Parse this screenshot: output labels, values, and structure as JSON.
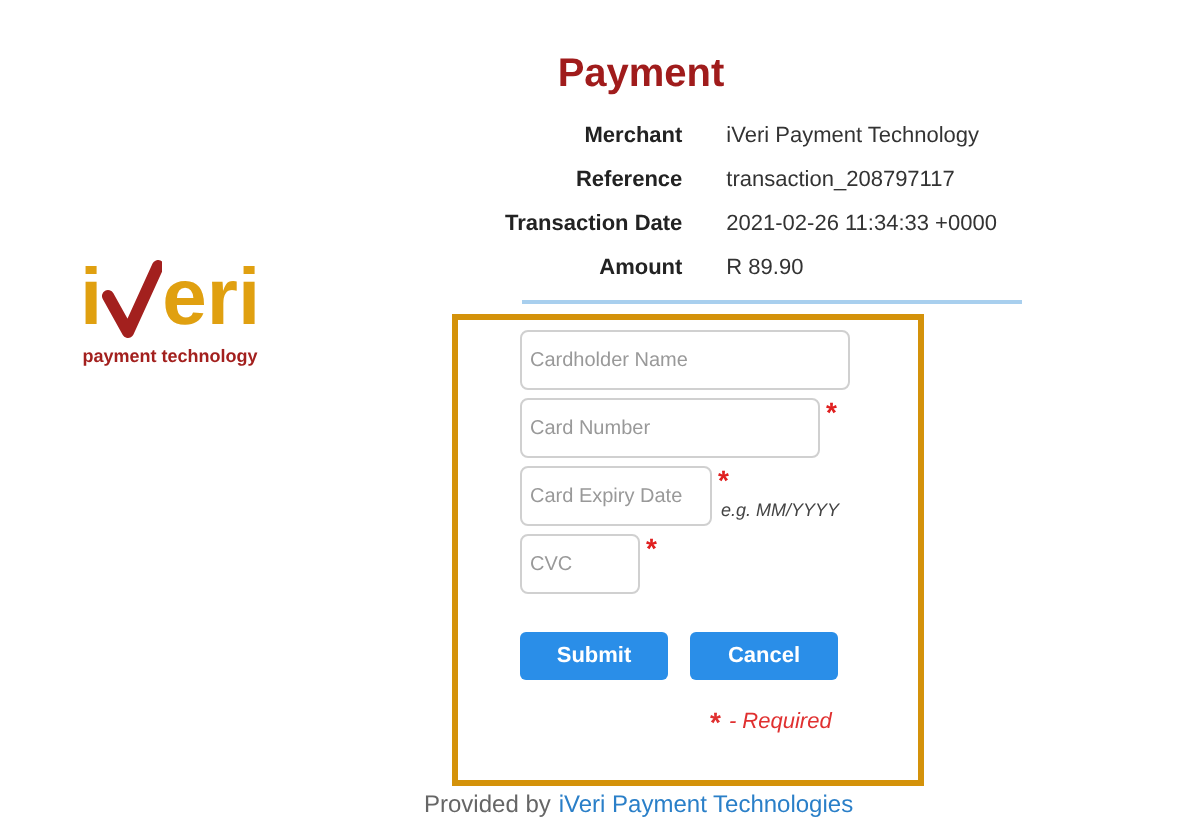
{
  "logo": {
    "name_start": "i",
    "name_end": "eri",
    "tagline": "payment technology"
  },
  "title": "Payment",
  "details": [
    {
      "label": "Merchant",
      "value": "iVeri Payment Technology"
    },
    {
      "label": "Reference",
      "value": "transaction_208797117"
    },
    {
      "label": "Transaction Date",
      "value": "2021-02-26 11:34:33 +0000"
    },
    {
      "label": "Amount",
      "value": "R 89.90"
    }
  ],
  "fields": [
    {
      "placeholder": "Cardholder Name",
      "required": false
    },
    {
      "placeholder": "Card Number",
      "required": true
    },
    {
      "placeholder": "Card Expiry Date",
      "required": true,
      "hint": "e.g. MM/YYYY"
    },
    {
      "placeholder": "CVC",
      "required": true
    }
  ],
  "buttons": [
    {
      "label": "Submit"
    },
    {
      "label": "Cancel"
    }
  ],
  "required_note": {
    "mark": "*",
    "text": "- Required"
  },
  "footer": {
    "text": "Provided by",
    "link": "iVeri Payment Technologies"
  }
}
